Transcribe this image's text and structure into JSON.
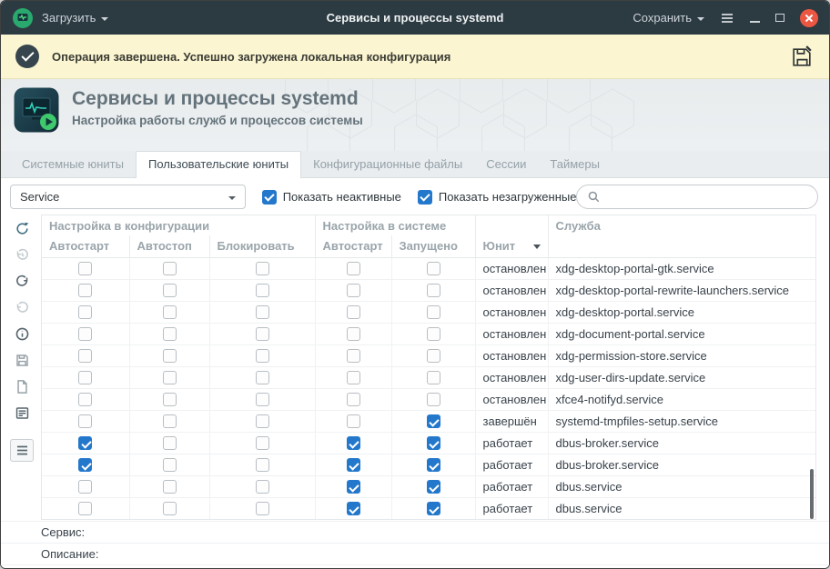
{
  "colors": {
    "accent_blue": "#2478cc",
    "titlebar_bg": "#2c3a42",
    "notification_bg": "#fbf5d1",
    "close_button": "#eb5743",
    "badge_green": "#3ec96c"
  },
  "titlebar": {
    "load_button": "Загрузить",
    "title": "Сервисы и процессы systemd",
    "save_button": "Сохранить"
  },
  "notification": {
    "message": "Операция завершена. Успешно загружена локальная конфигурация"
  },
  "header": {
    "title": "Сервисы и процессы systemd",
    "subtitle": "Настройка работы служб и процессов системы"
  },
  "tabs": [
    {
      "label": "Системные юниты"
    },
    {
      "label": "Пользовательские юниты"
    },
    {
      "label": "Конфигурационные файлы"
    },
    {
      "label": "Сессии"
    },
    {
      "label": "Таймеры"
    }
  ],
  "active_tab": 1,
  "filters": {
    "unit_type": "Service",
    "show_inactive_label": "Показать неактивные",
    "show_inactive_checked": true,
    "show_unloaded_label": "Показать незагруженные",
    "show_unloaded_checked": true,
    "search_value": ""
  },
  "toolbar_icons": [
    "refresh",
    "history-undo",
    "redo",
    "undo",
    "info",
    "save-file",
    "new-file",
    "details-view",
    "list-view"
  ],
  "table": {
    "group_headers": {
      "config": "Настройка в конфигурации",
      "system": "Настройка в системе",
      "service": "Служба"
    },
    "columns": [
      "Автостарт",
      "Автостоп",
      "Блокировать",
      "Автостарт",
      "Запущено",
      "Юнит"
    ],
    "sorted_column": "Юнит",
    "rows": [
      {
        "checks": [
          false,
          false,
          false,
          false,
          false
        ],
        "state": "остановлен",
        "service": "xdg-desktop-portal-gtk.service"
      },
      {
        "checks": [
          false,
          false,
          false,
          false,
          false
        ],
        "state": "остановлен",
        "service": "xdg-desktop-portal-rewrite-launchers.service"
      },
      {
        "checks": [
          false,
          false,
          false,
          false,
          false
        ],
        "state": "остановлен",
        "service": "xdg-desktop-portal.service"
      },
      {
        "checks": [
          false,
          false,
          false,
          false,
          false
        ],
        "state": "остановлен",
        "service": "xdg-document-portal.service"
      },
      {
        "checks": [
          false,
          false,
          false,
          false,
          false
        ],
        "state": "остановлен",
        "service": "xdg-permission-store.service"
      },
      {
        "checks": [
          false,
          false,
          false,
          false,
          false
        ],
        "state": "остановлен",
        "service": "xdg-user-dirs-update.service"
      },
      {
        "checks": [
          false,
          false,
          false,
          false,
          false
        ],
        "state": "остановлен",
        "service": "xfce4-notifyd.service"
      },
      {
        "checks": [
          false,
          false,
          false,
          false,
          true
        ],
        "state": "завершён",
        "service": "systemd-tmpfiles-setup.service"
      },
      {
        "checks": [
          true,
          false,
          false,
          true,
          true
        ],
        "state": "работает",
        "service": "dbus-broker.service"
      },
      {
        "checks": [
          true,
          false,
          false,
          true,
          true
        ],
        "state": "работает",
        "service": "dbus-broker.service"
      },
      {
        "checks": [
          false,
          false,
          false,
          true,
          true
        ],
        "state": "работает",
        "service": "dbus.service"
      },
      {
        "checks": [
          false,
          false,
          false,
          true,
          true
        ],
        "state": "работает",
        "service": "dbus.service"
      }
    ]
  },
  "footer": {
    "service_label": "Сервис:",
    "description_label": "Описание:"
  }
}
